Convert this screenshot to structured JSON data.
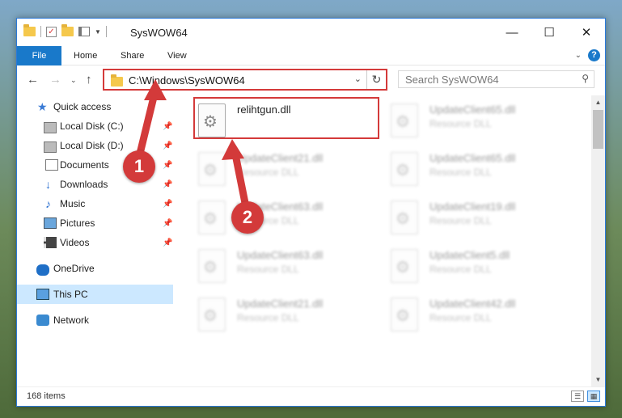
{
  "window": {
    "title": "SysWOW64",
    "controls": {
      "minimize": "—",
      "maximize": "☐",
      "close": "✕"
    }
  },
  "ribbon": {
    "tabs": [
      "File",
      "Home",
      "Share",
      "View"
    ],
    "help": "?"
  },
  "address": {
    "path": "C:\\Windows\\SysWOW64",
    "search_placeholder": "Search SysWOW64"
  },
  "nav_pane": {
    "quick_access": "Quick access",
    "items": [
      {
        "label": "Local Disk (C:)",
        "icon": "drive-icon",
        "pinned": true
      },
      {
        "label": "Local Disk (D:)",
        "icon": "drive-icon",
        "pinned": true
      },
      {
        "label": "Documents",
        "icon": "documents-icon",
        "pinned": true
      },
      {
        "label": "Downloads",
        "icon": "downloads-icon",
        "pinned": true
      },
      {
        "label": "Music",
        "icon": "music-icon",
        "pinned": true
      },
      {
        "label": "Pictures",
        "icon": "pictures-icon",
        "pinned": true
      },
      {
        "label": "Videos",
        "icon": "videos-icon",
        "pinned": true
      }
    ],
    "onedrive": "OneDrive",
    "this_pc": "This PC",
    "network": "Network"
  },
  "files": [
    {
      "name": "relihtgun.dll",
      "type": ""
    },
    {
      "name": "UpdateClient65.dll",
      "type": "Resource DLL"
    },
    {
      "name": "UpdateClient21.dll",
      "type": "Resource DLL"
    },
    {
      "name": "UpdateClient65.dll",
      "type": "Resource DLL"
    },
    {
      "name": "UpdateClient63.dll",
      "type": "Resource DLL"
    },
    {
      "name": "UpdateClient19.dll",
      "type": "Resource DLL"
    },
    {
      "name": "UpdateClient63.dll",
      "type": "Resource DLL"
    },
    {
      "name": "UpdateClient5.dll",
      "type": "Resource DLL"
    },
    {
      "name": "UpdateClient21.dll",
      "type": "Resource DLL"
    },
    {
      "name": "UpdateClient42.dll",
      "type": "Resource DLL"
    }
  ],
  "status": {
    "item_count": "168 items"
  },
  "annotations": {
    "step1": "1",
    "step2": "2",
    "color": "#d33a3a"
  }
}
